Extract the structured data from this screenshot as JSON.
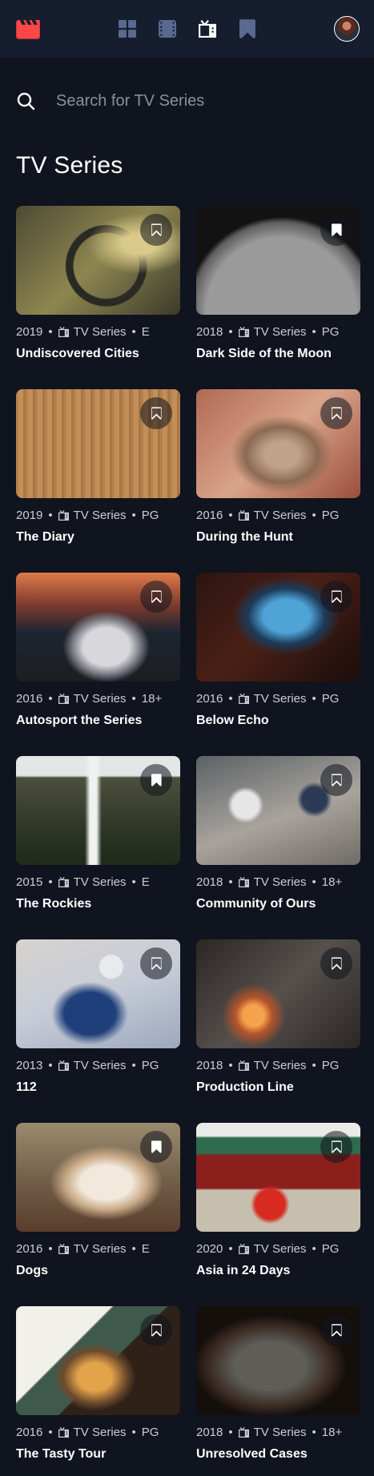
{
  "nav": {
    "icons": [
      "logo-clapperboard-icon",
      "home-grid-icon",
      "movies-film-icon",
      "tv-series-icon",
      "bookmark-icon",
      "avatar"
    ],
    "active": "tv-series",
    "colors": {
      "logo": "#fc4747",
      "inactive": "#5a698f",
      "active": "#ffffff",
      "bar": "#161d2f"
    }
  },
  "search": {
    "placeholder": "Search for TV Series",
    "value": ""
  },
  "section": {
    "title": "TV Series"
  },
  "colors": {
    "background": "#10141e",
    "accent": "#fc4747"
  },
  "cards": [
    {
      "year": "2019",
      "category": "TV Series",
      "rating": "E",
      "title": "Undiscovered Cities",
      "bookmarked": false
    },
    {
      "year": "2018",
      "category": "TV Series",
      "rating": "PG",
      "title": "Dark Side of the Moon",
      "bookmarked": true
    },
    {
      "year": "2019",
      "category": "TV Series",
      "rating": "PG",
      "title": "The Diary",
      "bookmarked": false
    },
    {
      "year": "2016",
      "category": "TV Series",
      "rating": "PG",
      "title": "During the Hunt",
      "bookmarked": false
    },
    {
      "year": "2016",
      "category": "TV Series",
      "rating": "18+",
      "title": "Autosport the Series",
      "bookmarked": false
    },
    {
      "year": "2016",
      "category": "TV Series",
      "rating": "PG",
      "title": "Below Echo",
      "bookmarked": false
    },
    {
      "year": "2015",
      "category": "TV Series",
      "rating": "E",
      "title": "The Rockies",
      "bookmarked": true
    },
    {
      "year": "2018",
      "category": "TV Series",
      "rating": "18+",
      "title": "Community of Ours",
      "bookmarked": false
    },
    {
      "year": "2013",
      "category": "TV Series",
      "rating": "PG",
      "title": "112",
      "bookmarked": false
    },
    {
      "year": "2018",
      "category": "TV Series",
      "rating": "PG",
      "title": "Production Line",
      "bookmarked": false
    },
    {
      "year": "2016",
      "category": "TV Series",
      "rating": "E",
      "title": "Dogs",
      "bookmarked": true
    },
    {
      "year": "2020",
      "category": "TV Series",
      "rating": "PG",
      "title": "Asia in 24 Days",
      "bookmarked": false
    },
    {
      "year": "2016",
      "category": "TV Series",
      "rating": "PG",
      "title": "The Tasty Tour",
      "bookmarked": false
    },
    {
      "year": "2018",
      "category": "TV Series",
      "rating": "18+",
      "title": "Unresolved Cases",
      "bookmarked": false
    }
  ]
}
